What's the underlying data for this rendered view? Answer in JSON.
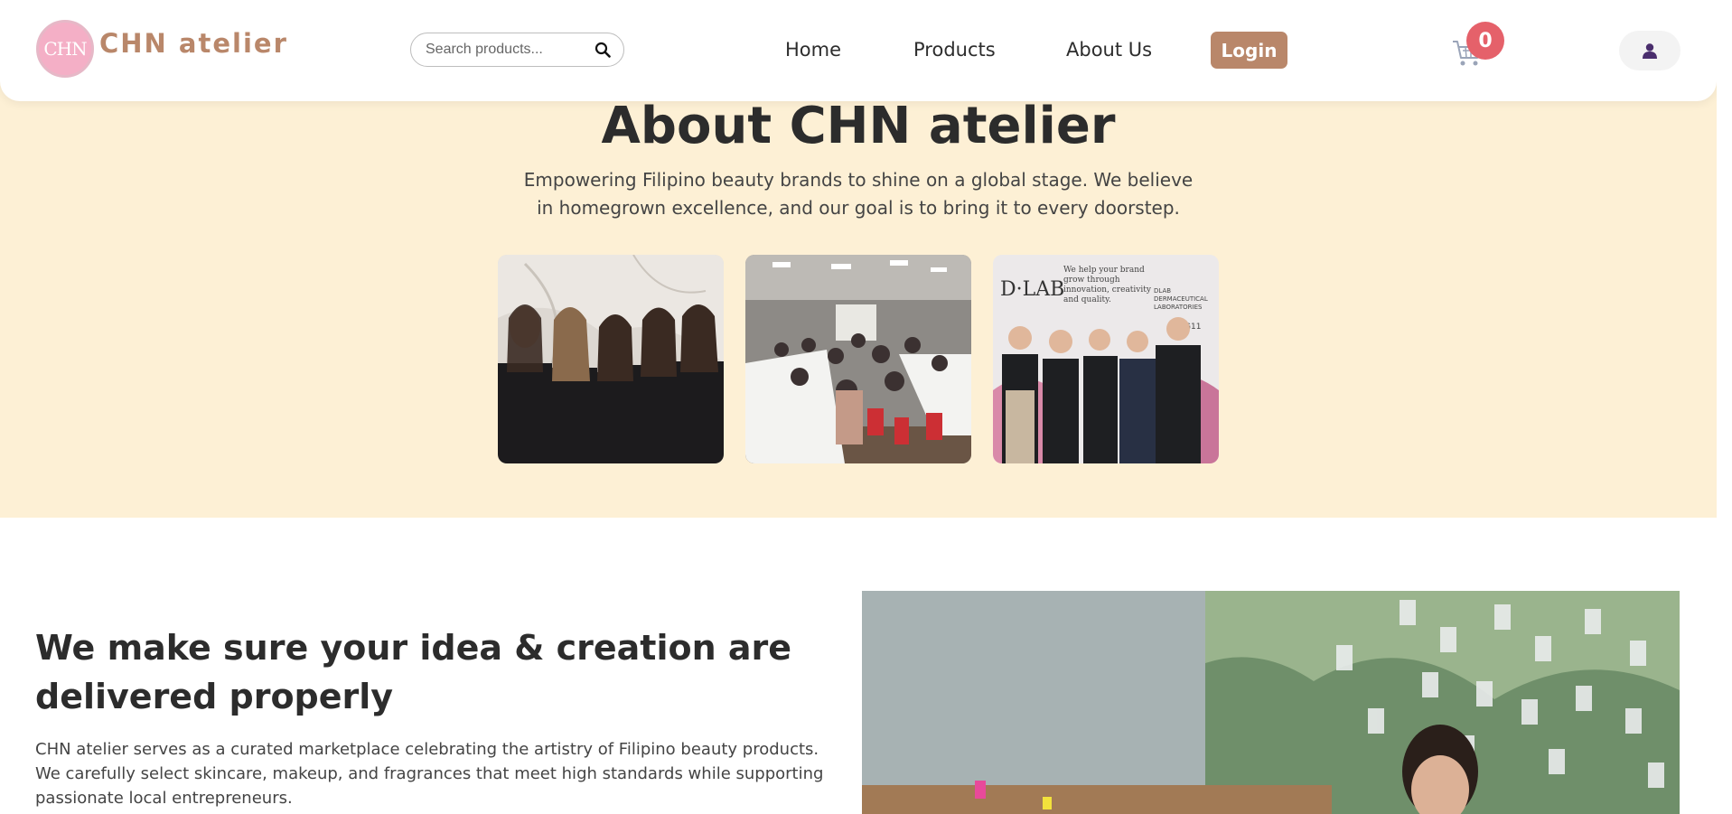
{
  "header": {
    "logo_text": "CHN",
    "brand": "CHN atelier",
    "search": {
      "placeholder": "Search products..."
    },
    "nav": {
      "home": "Home",
      "products": "Products",
      "about": "About Us"
    },
    "login_label": "Login",
    "cart_count": "0"
  },
  "hero": {
    "title": "About CHN atelier",
    "subtitle": "Empowering Filipino beauty brands to shine on a global stage. We believe in homegrown excellence, and our goal is to bring it to every doorstep.",
    "photo3_sign": "D·LAB",
    "photo3_tagline": "We help your brand grow through innovation, creativity and quality.",
    "photo3_lab": "DLAB DERMACEUTICAL LABORATORIES",
    "photo3_booth": "G11"
  },
  "mission": {
    "title": "We make sure your idea & creation are delivered properly",
    "text": "CHN atelier serves as a curated marketplace celebrating the artistry of Filipino beauty products. We carefully select skincare, makeup, and fragrances that meet high standards while supporting passionate local entrepreneurs."
  },
  "colors": {
    "accent": "#b9876a",
    "hero_bg": "#fdf0d5",
    "badge": "#e5616a",
    "logo_pink": "#f4afc6"
  },
  "icons": {
    "search": "search-icon",
    "cart": "cart-icon",
    "user": "user-icon"
  }
}
